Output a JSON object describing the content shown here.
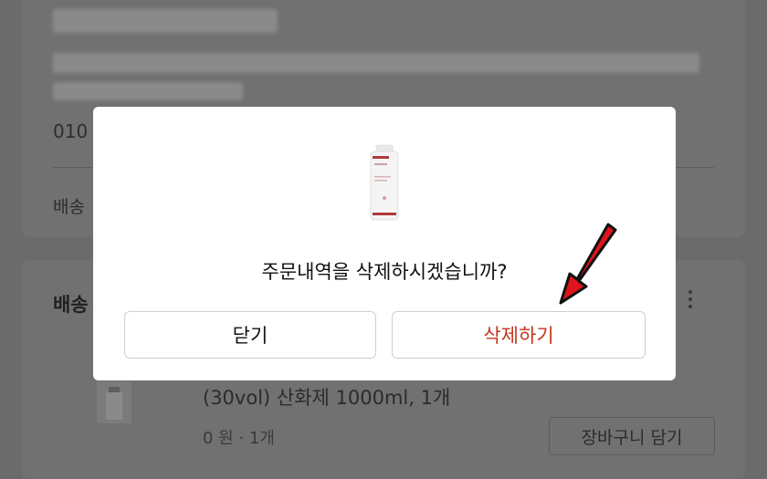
{
  "background": {
    "phone_partial": "010",
    "shipping_partial": "배송",
    "section_partial": "배송",
    "product_name_line": "(30vol) 산화제 1000ml, 1개",
    "price_qty": "0 원 · 1개",
    "add_to_cart_label": "장바구니 담기"
  },
  "dialog": {
    "message": "주문내역을 삭제하시겠습니까?",
    "close_label": "닫기",
    "delete_label": "삭제하기"
  },
  "colors": {
    "delete_accent": "#c4361f",
    "annotation_arrow": "#e0141c"
  }
}
